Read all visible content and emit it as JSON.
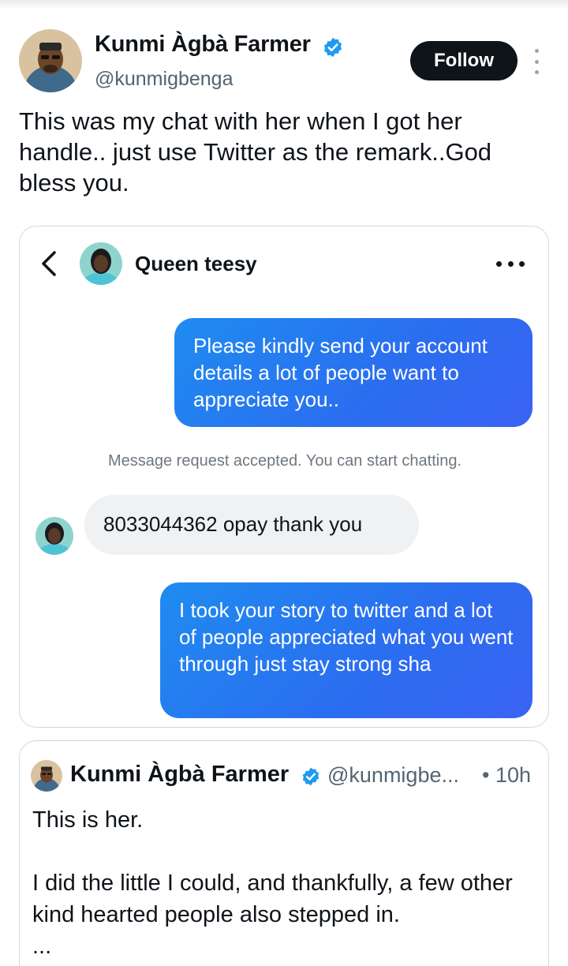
{
  "tweet": {
    "author_name": "Kunmi Àgbà Farmer",
    "author_handle": "@kunmigbenga",
    "follow_label": "Follow",
    "text": "This was my chat with her when I got her handle.. just use Twitter as the remark..God bless you.",
    "avatar_icon": "profile-photo",
    "verified_icon": "verified-badge-icon",
    "more_icon": "more-vertical-icon"
  },
  "chat": {
    "contact_name": "Queen teesy",
    "back_icon": "chevron-left-icon",
    "more_icon": "more-horizontal-icon",
    "messages": [
      {
        "direction": "outgoing",
        "text": "Please kindly send your account details a lot of people want to appreciate you.."
      },
      {
        "direction": "system",
        "text": "Message request accepted. You can start chatting."
      },
      {
        "direction": "incoming",
        "text": "8033044362 opay thank you"
      },
      {
        "direction": "outgoing",
        "text": "I took your story to twitter and a lot of people appreciated what you went through just stay strong sha"
      }
    ]
  },
  "quoted_tweet": {
    "author_name": "Kunmi Àgbà Farmer",
    "author_handle": "@kunmigbe...",
    "time": "• 10h",
    "text": "This is her.\n\nI did the little I could, and thankfully, a few other kind hearted people also stepped in.\n..."
  },
  "colors": {
    "accent": "#1d9bf0",
    "bubble_outgoing": "#2b6df0",
    "bubble_incoming": "#eff1f3",
    "secondary_text": "#536471"
  }
}
